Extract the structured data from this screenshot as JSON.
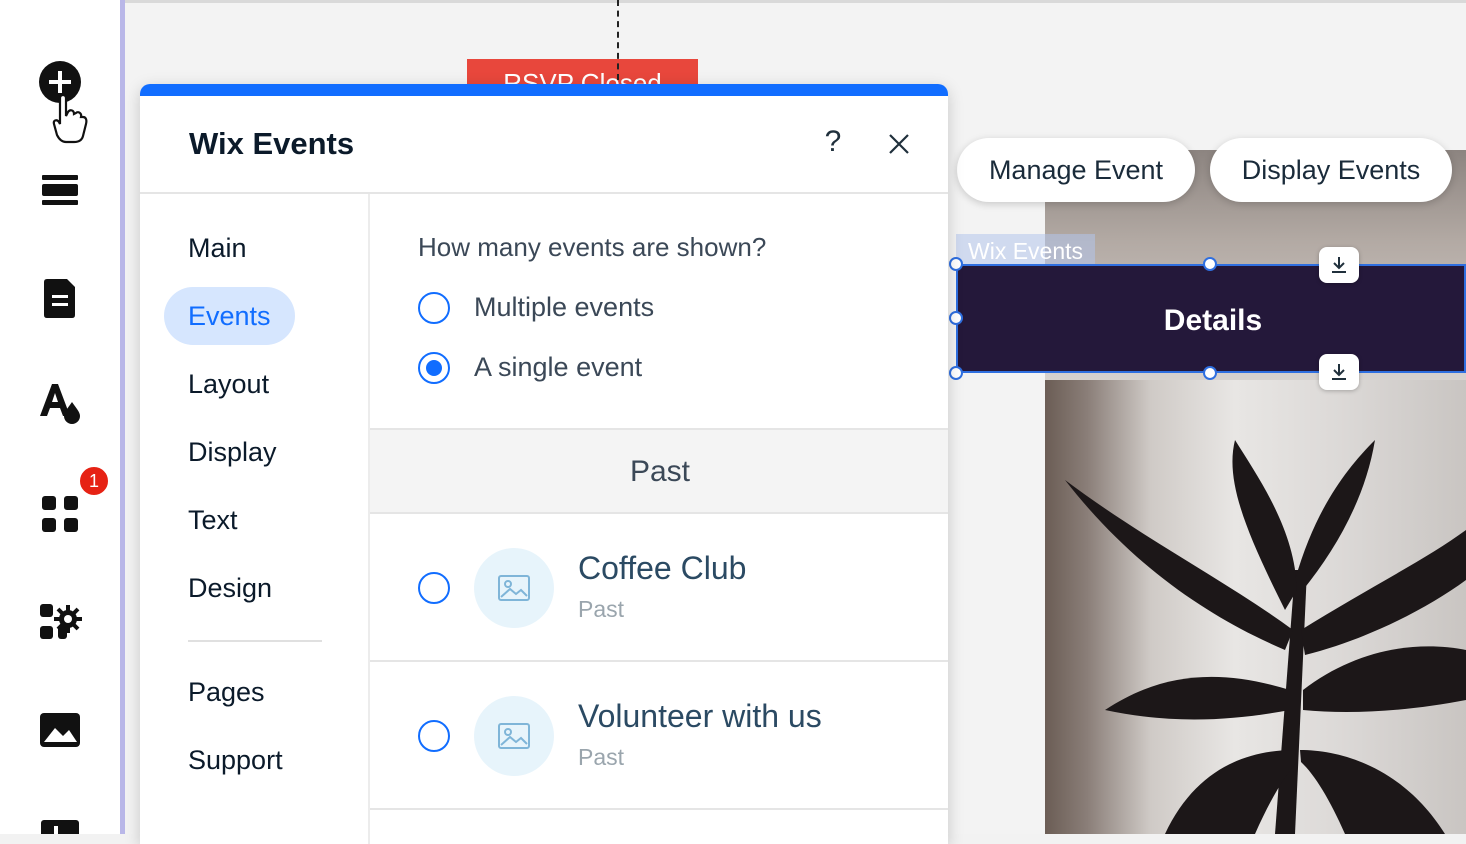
{
  "canvas": {
    "rsvp_banner": "RSVP Closed",
    "widget_label": "Wix Events",
    "widget_button": "Details",
    "actions": {
      "manage": "Manage Event",
      "display": "Display Events"
    }
  },
  "toolbar": {
    "apps_badge": "1",
    "tools": [
      "add-icon",
      "sections-icon",
      "pages-icon",
      "design-icon",
      "apps-icon",
      "business-icon",
      "media-icon",
      "layout-icon"
    ]
  },
  "panel": {
    "title": "Wix Events",
    "help": "?",
    "nav": [
      "Main",
      "Events",
      "Layout",
      "Display",
      "Text",
      "Design",
      "Pages",
      "Support"
    ],
    "active_nav": "Events",
    "content": {
      "question": "How many events are shown?",
      "options": [
        {
          "label": "Multiple events",
          "selected": false
        },
        {
          "label": "A single event",
          "selected": true
        }
      ],
      "section": "Past",
      "events": [
        {
          "title": "Coffee Club",
          "status": "Past"
        },
        {
          "title": "Volunteer with us",
          "status": "Past"
        }
      ]
    }
  },
  "colors": {
    "accent": "#116dff",
    "widget": "#24183a",
    "badge": "#e62214"
  }
}
